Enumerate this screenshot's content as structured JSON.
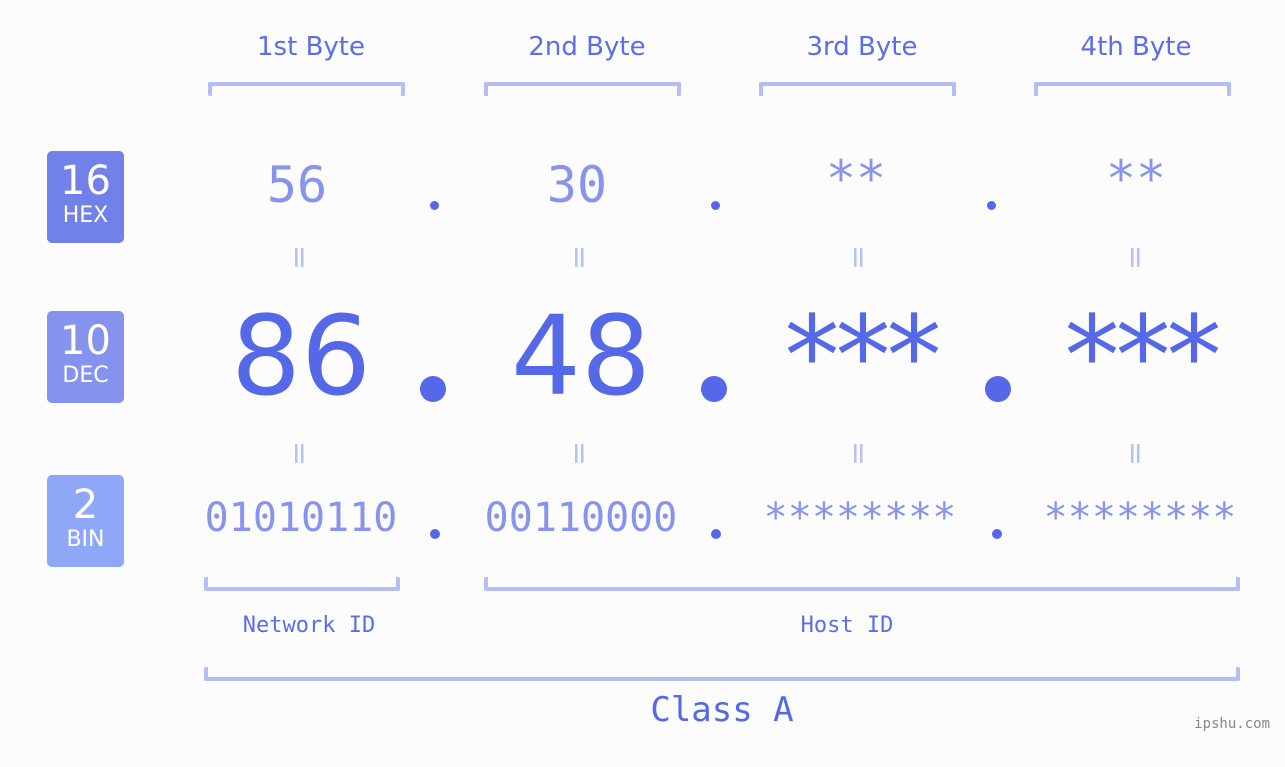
{
  "bytes": [
    {
      "header": "1st Byte",
      "hex": "56",
      "dec": "86",
      "bin": "01010110"
    },
    {
      "header": "2nd Byte",
      "hex": "30",
      "dec": "48",
      "bin": "00110000"
    },
    {
      "header": "3rd Byte",
      "hex": "**",
      "dec": "***",
      "bin": "********"
    },
    {
      "header": "4th Byte",
      "hex": "**",
      "dec": "***",
      "bin": "********"
    }
  ],
  "badges": {
    "hex": {
      "num": "16",
      "label": "HEX",
      "color": "#7281ea"
    },
    "dec": {
      "num": "10",
      "label": "DEC",
      "color": "#8593ef"
    },
    "bin": {
      "num": "2",
      "label": "BIN",
      "color": "#8ea7f7"
    }
  },
  "equals_sign": "=",
  "network_id_label": "Network ID",
  "host_id_label": "Host ID",
  "class_label": "Class A",
  "watermark": "ipshu.com",
  "colors": {
    "accent": "#5468e8",
    "light_text": "#8793ec",
    "bracket": "#b3bdf6"
  }
}
